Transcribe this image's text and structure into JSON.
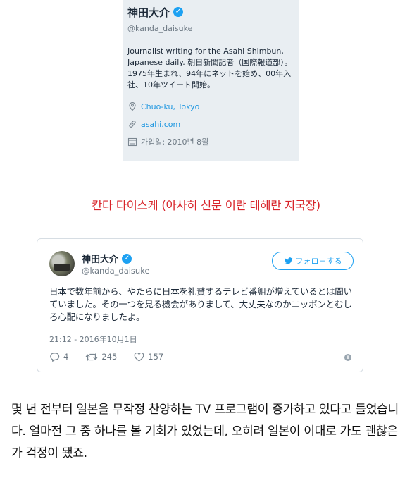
{
  "profile": {
    "name": "神田大介",
    "handle": "@kanda_daisuke",
    "bio": "Journalist writing for the Asahi Shimbun, Japanese daily. 朝日新聞記者（国際報道部）。1975年生まれ、94年にネットを始め、00年入社、10年ツイート開始。",
    "location": "Chuo-ku, Tokyo",
    "website": "asahi.com",
    "joined": "가입일: 2010년 8월",
    "icons": {
      "location": "location-pin-icon",
      "website": "link-icon",
      "joined": "calendar-icon"
    }
  },
  "caption": "칸다 다이스케 (아사히 신문 이란 테헤란 지국장)",
  "tweet": {
    "name": "神田大介",
    "handle": "@kanda_daisuke",
    "follow_label": "フォロ－する",
    "text": "日本で数年前から、やたらに日本を礼賛するテレビ番組が増えているとは聞いていました。その一つを見る機会がありまして、大丈夫なのかニッポンとむしろ心配になりましたよ。",
    "timestamp": "21:12 - 2016年10月1日",
    "replies": "4",
    "retweets": "245",
    "likes": "157"
  },
  "subtitle": "몇 년 전부터 일본을 무작정 찬양하는 TV 프로그램이 증가하고 있다고 들었습니다. 얼마전 그 중 하나를 볼 기회가 있었는데, 오히려 일본이 이대로 가도 괜찮은가 걱정이 됐죠.",
  "colors": {
    "accent": "#1da1f2",
    "link": "#1b95e0",
    "caption": "#d8242a",
    "profile_bg": "#e9eef2"
  }
}
